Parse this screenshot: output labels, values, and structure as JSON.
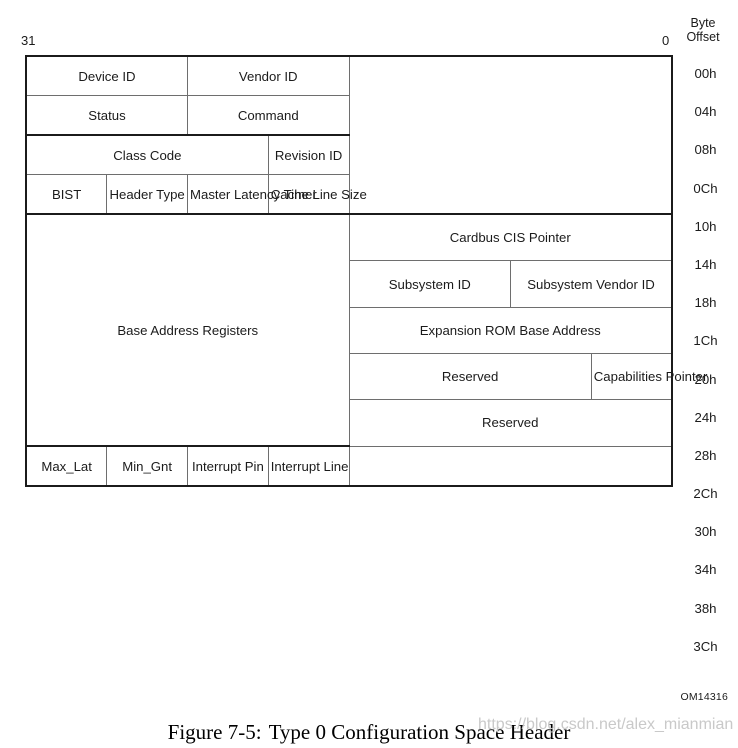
{
  "header": {
    "byte_offset_line1": "Byte",
    "byte_offset_line2": "Offset",
    "bit_high": "31",
    "bit_low": "0"
  },
  "rows": [
    {
      "offset": "00h",
      "cells": [
        {
          "label": "Device ID",
          "span": 2
        },
        {
          "label": "Vendor ID",
          "span": 2
        }
      ]
    },
    {
      "offset": "04h",
      "cells": [
        {
          "label": "Status",
          "span": 2
        },
        {
          "label": "Command",
          "span": 2
        }
      ]
    },
    {
      "offset": "08h",
      "cells": [
        {
          "label": "Class Code",
          "span": 3
        },
        {
          "label": "Revision ID",
          "span": 1
        }
      ]
    },
    {
      "offset": "0Ch",
      "cells": [
        {
          "label": "BIST",
          "span": 1
        },
        {
          "label": "Header Type",
          "span": 1
        },
        {
          "label": "Master Latency Timer",
          "span": 1
        },
        {
          "label": "Cache Line Size",
          "span": 1
        }
      ]
    },
    {
      "offset": "10h",
      "cells": [
        {
          "label": "Base Address Registers",
          "span": 4
        }
      ]
    },
    {
      "offset": "14h",
      "cells": []
    },
    {
      "offset": "18h",
      "cells": []
    },
    {
      "offset": "1Ch",
      "cells": []
    },
    {
      "offset": "20h",
      "cells": []
    },
    {
      "offset": "24h",
      "cells": []
    },
    {
      "offset": "28h",
      "cells": [
        {
          "label": "Cardbus CIS Pointer",
          "span": 4
        }
      ]
    },
    {
      "offset": "2Ch",
      "cells": [
        {
          "label": "Subsystem ID",
          "span": 2
        },
        {
          "label": "Subsystem Vendor ID",
          "span": 2
        }
      ]
    },
    {
      "offset": "30h",
      "cells": [
        {
          "label": "Expansion ROM Base Address",
          "span": 4
        }
      ]
    },
    {
      "offset": "34h",
      "cells": [
        {
          "label": "Reserved",
          "span": 3
        },
        {
          "label": "Capabilities Pointer",
          "span": 1
        }
      ]
    },
    {
      "offset": "38h",
      "cells": [
        {
          "label": "Reserved",
          "span": 4
        }
      ]
    },
    {
      "offset": "3Ch",
      "cells": [
        {
          "label": "Max_Lat",
          "span": 1
        },
        {
          "label": "Min_Gnt",
          "span": 1
        },
        {
          "label": "Interrupt Pin",
          "span": 1
        },
        {
          "label": "Interrupt Line",
          "span": 1
        }
      ]
    }
  ],
  "offsets": [
    "00h",
    "04h",
    "08h",
    "0Ch",
    "10h",
    "14h",
    "18h",
    "1Ch",
    "20h",
    "24h",
    "28h",
    "2Ch",
    "30h",
    "34h",
    "38h",
    "3Ch"
  ],
  "figure": {
    "id": "OM14316",
    "caption_number": "Figure 7-5:",
    "caption_title": "Type 0 Configuration Space Header"
  },
  "watermark": {
    "text": "https://blog.csdn.net/alex_mianmian"
  }
}
